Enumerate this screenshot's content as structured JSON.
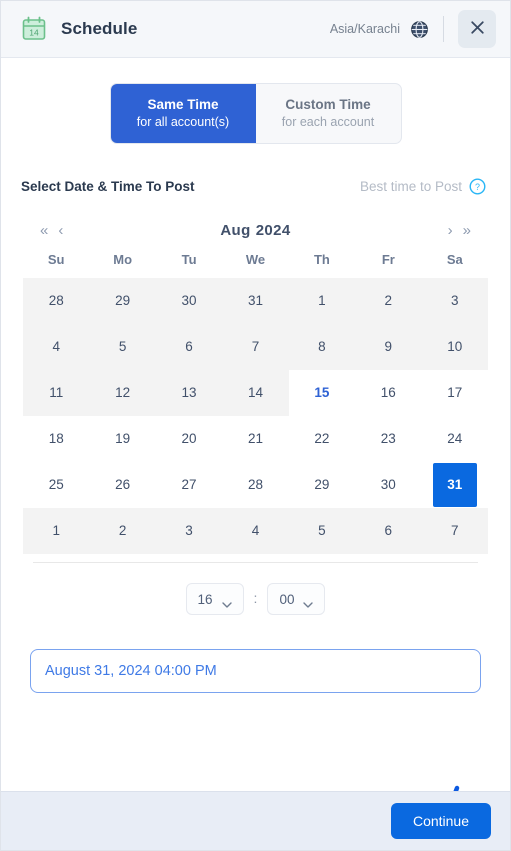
{
  "header": {
    "title": "Schedule",
    "calendar_icon_day": "14",
    "timezone": "Asia/Karachi",
    "globe_icon": "globe-icon",
    "close_icon": "close-icon"
  },
  "mode_toggle": {
    "options": [
      {
        "title": "Same Time",
        "subtitle": "for all account(s)",
        "active": true
      },
      {
        "title": "Custom Time",
        "subtitle": "for each account",
        "active": false
      }
    ]
  },
  "section": {
    "title": "Select Date & Time To Post",
    "best_time_label": "Best time to Post",
    "help_icon": "help-circle-icon"
  },
  "calendar": {
    "nav": {
      "prev_year": "«",
      "prev_month": "‹",
      "next_month": "›",
      "next_year": "»"
    },
    "month": "Aug",
    "year": "2024",
    "weekdays": [
      "Su",
      "Mo",
      "Tu",
      "We",
      "Th",
      "Fr",
      "Sa"
    ],
    "weeks": [
      [
        {
          "d": "28",
          "state": "disabled"
        },
        {
          "d": "29",
          "state": "disabled"
        },
        {
          "d": "30",
          "state": "disabled"
        },
        {
          "d": "31",
          "state": "disabled"
        },
        {
          "d": "1",
          "state": "disabled"
        },
        {
          "d": "2",
          "state": "disabled"
        },
        {
          "d": "3",
          "state": "disabled"
        }
      ],
      [
        {
          "d": "4",
          "state": "disabled"
        },
        {
          "d": "5",
          "state": "disabled"
        },
        {
          "d": "6",
          "state": "disabled"
        },
        {
          "d": "7",
          "state": "disabled"
        },
        {
          "d": "8",
          "state": "disabled"
        },
        {
          "d": "9",
          "state": "disabled"
        },
        {
          "d": "10",
          "state": "disabled"
        }
      ],
      [
        {
          "d": "11",
          "state": "disabled"
        },
        {
          "d": "12",
          "state": "disabled"
        },
        {
          "d": "13",
          "state": "disabled"
        },
        {
          "d": "14",
          "state": "disabled"
        },
        {
          "d": "15",
          "state": "today"
        },
        {
          "d": "16",
          "state": "normal"
        },
        {
          "d": "17",
          "state": "normal"
        }
      ],
      [
        {
          "d": "18",
          "state": "normal"
        },
        {
          "d": "19",
          "state": "normal"
        },
        {
          "d": "20",
          "state": "normal"
        },
        {
          "d": "21",
          "state": "normal"
        },
        {
          "d": "22",
          "state": "normal"
        },
        {
          "d": "23",
          "state": "normal"
        },
        {
          "d": "24",
          "state": "normal"
        }
      ],
      [
        {
          "d": "25",
          "state": "normal"
        },
        {
          "d": "26",
          "state": "normal"
        },
        {
          "d": "27",
          "state": "normal"
        },
        {
          "d": "28",
          "state": "normal"
        },
        {
          "d": "29",
          "state": "normal"
        },
        {
          "d": "30",
          "state": "normal"
        },
        {
          "d": "31",
          "state": "selected"
        }
      ],
      [
        {
          "d": "1",
          "state": "disabled"
        },
        {
          "d": "2",
          "state": "disabled"
        },
        {
          "d": "3",
          "state": "disabled"
        },
        {
          "d": "4",
          "state": "disabled"
        },
        {
          "d": "5",
          "state": "disabled"
        },
        {
          "d": "6",
          "state": "disabled"
        },
        {
          "d": "7",
          "state": "disabled"
        }
      ]
    ]
  },
  "time": {
    "hour": "16",
    "minute": "00",
    "separator": ":"
  },
  "result": {
    "value": "August 31, 2024 04:00 PM"
  },
  "footer": {
    "continue_label": "Continue"
  },
  "colors": {
    "accent_blue": "#0a69e0",
    "toggle_active": "#2f62d4",
    "calendar_green": "#6cc08b",
    "footer_bg": "#e8edf6",
    "header_bg": "#f5f7fa",
    "annotation_arrow": "#0d5ae0"
  }
}
